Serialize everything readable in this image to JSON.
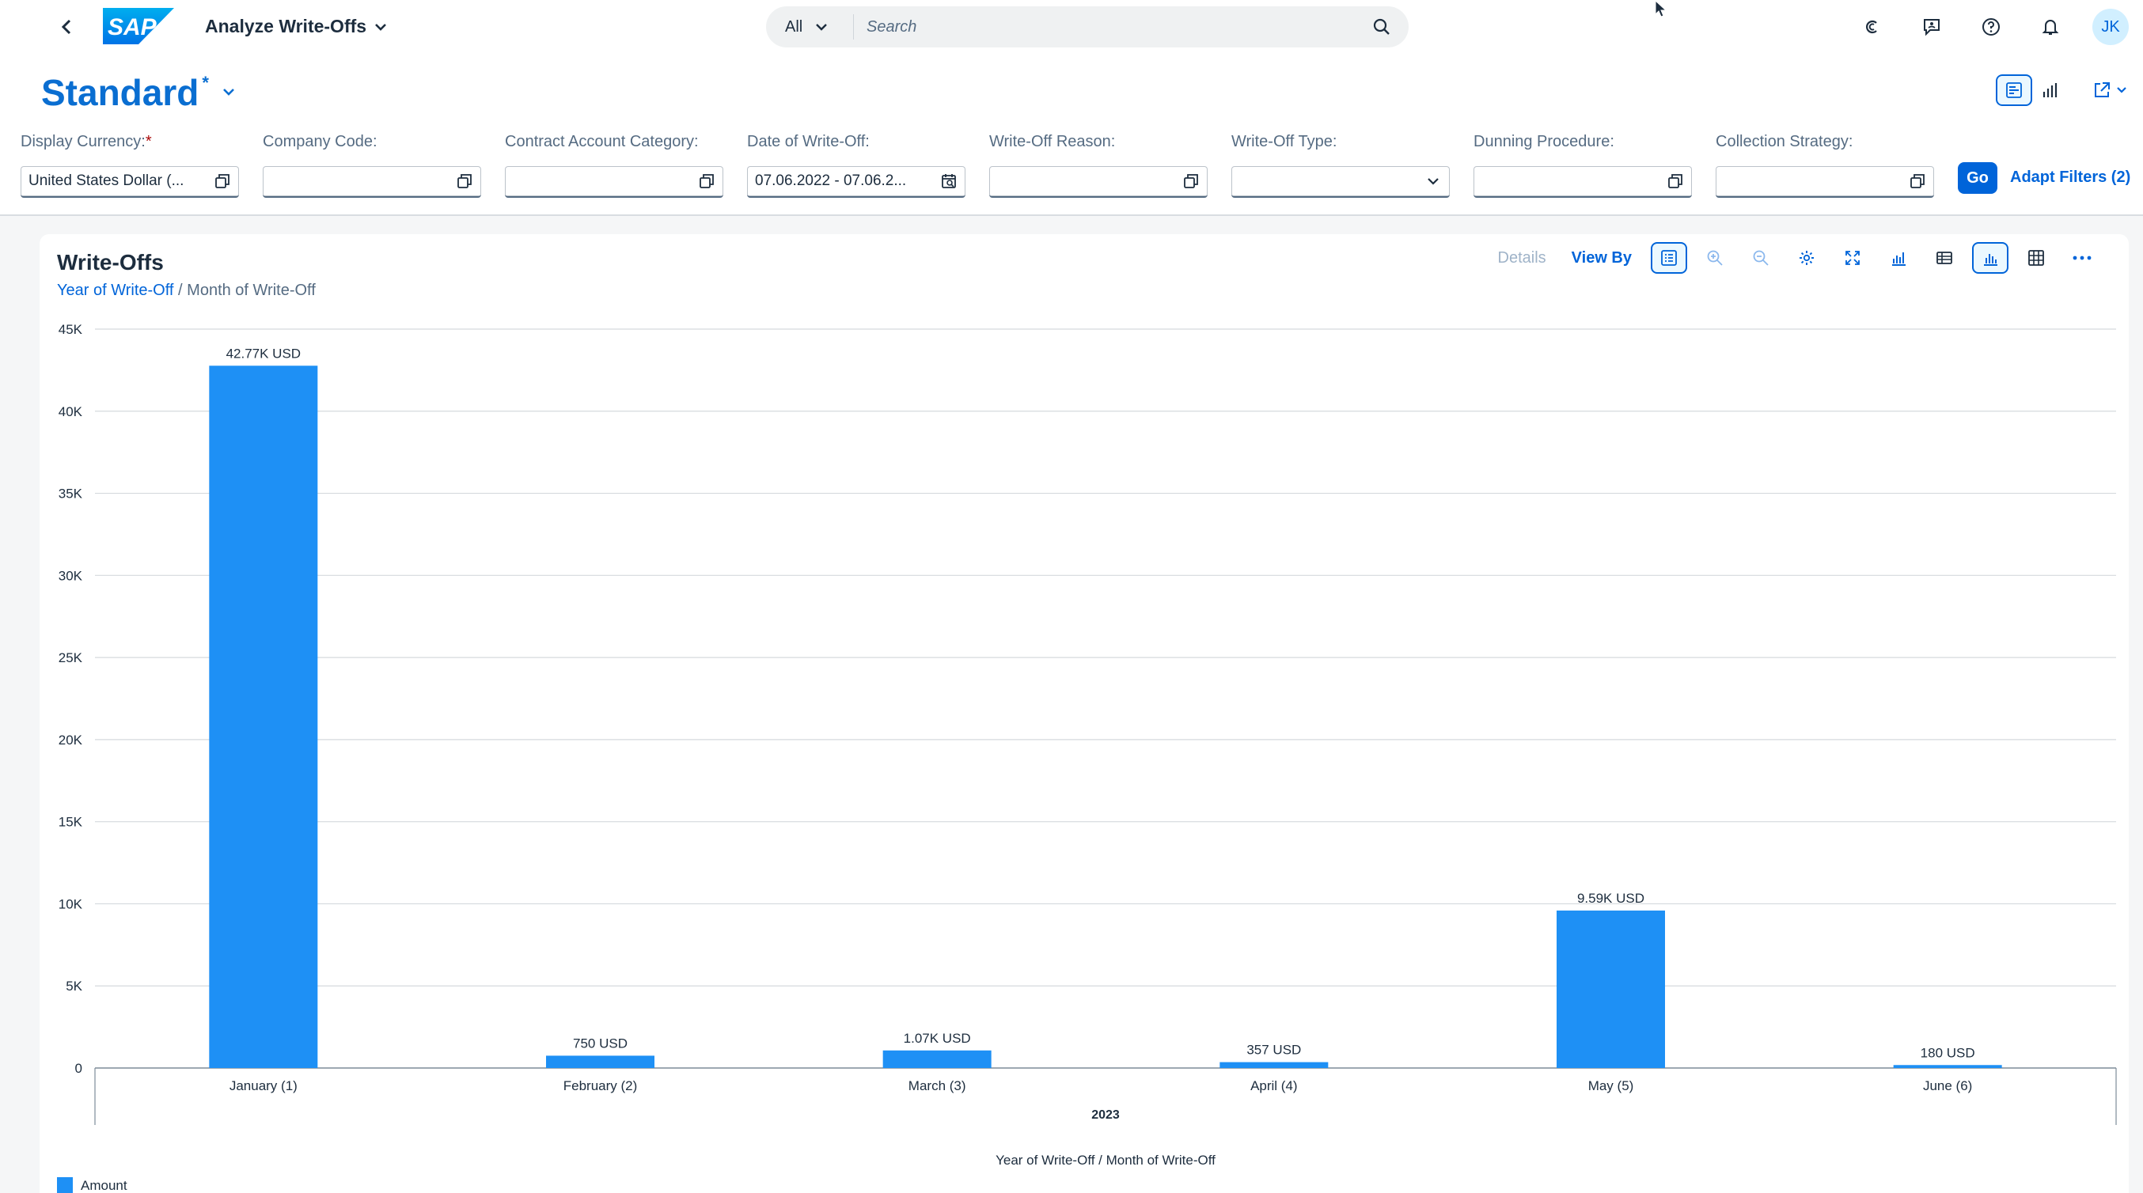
{
  "shell": {
    "logo_text": "SAP",
    "app_title": "Analyze Write-Offs",
    "search_scope": "All",
    "search_placeholder": "Search",
    "avatar_initials": "JK"
  },
  "variant": {
    "title": "Standard",
    "modified_marker": "*"
  },
  "filters": [
    {
      "label": "Display Currency:",
      "required": "*",
      "value": "United States Dollar (...",
      "icon": "value-help-icon"
    },
    {
      "label": "Company Code:",
      "value": "",
      "icon": "value-help-icon"
    },
    {
      "label": "Contract Account Category:",
      "value": "",
      "icon": "value-help-icon"
    },
    {
      "label": "Date of Write-Off:",
      "value": "07.06.2022 - 07.06.2...",
      "icon": "calendar-icon"
    },
    {
      "label": "Write-Off Reason:",
      "value": "",
      "icon": "value-help-icon"
    },
    {
      "label": "Write-Off Type:",
      "value": "",
      "icon": "dropdown-icon"
    },
    {
      "label": "Dunning Procedure:",
      "value": "",
      "icon": "value-help-icon"
    },
    {
      "label": "Collection Strategy:",
      "value": "",
      "icon": "value-help-icon"
    }
  ],
  "filterbar": {
    "go_label": "Go",
    "adapt_label": "Adapt Filters (2)"
  },
  "card": {
    "title": "Write-Offs",
    "drill_link": "Year of Write-Off",
    "drill_sep": " / ",
    "drill_current": "Month of Write-Off",
    "details_label": "Details",
    "viewby_label": "View By"
  },
  "colors": {
    "accent": "#0064d9",
    "bar": "#1e90f5",
    "title_blue": "#0a6ed1"
  },
  "chart_data": {
    "type": "bar",
    "categories": [
      "January (1)",
      "February (2)",
      "March (3)",
      "April (4)",
      "May (5)",
      "June (6)"
    ],
    "group_label": "2023",
    "series": [
      {
        "name": "Amount",
        "values": [
          42770,
          750,
          1070,
          357,
          9590,
          180
        ],
        "labels": [
          "42.77K USD",
          "750 USD",
          "1.07K USD",
          "357 USD",
          "9.59K USD",
          "180 USD"
        ]
      }
    ],
    "xlabel": "Year of Write-Off / Month of Write-Off",
    "ylabel": "",
    "ylim": [
      0,
      45000
    ],
    "yticks": [
      0,
      5000,
      10000,
      15000,
      20000,
      25000,
      30000,
      35000,
      40000,
      45000
    ],
    "ytick_labels": [
      "0",
      "5K",
      "10K",
      "15K",
      "20K",
      "25K",
      "30K",
      "35K",
      "40K",
      "45K"
    ],
    "grid": true,
    "legend": "bottom-left"
  }
}
